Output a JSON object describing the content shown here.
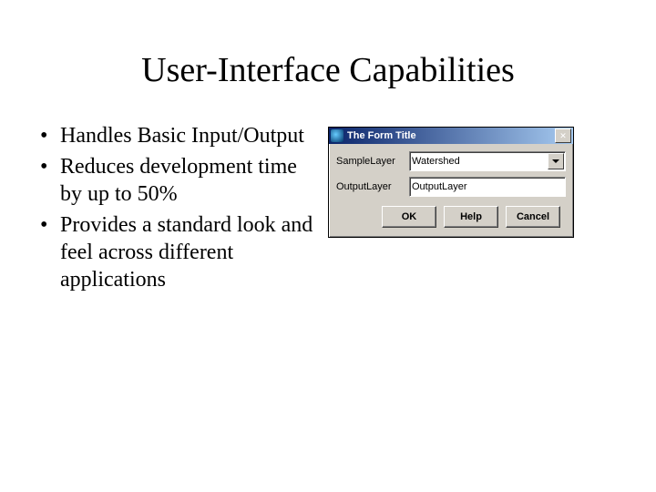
{
  "slide": {
    "title": "User-Interface Capabilities",
    "bullets": [
      "Handles Basic Input/Output",
      "Reduces development time by up to 50%",
      "Provides a standard look and feel across different applications"
    ]
  },
  "dialog": {
    "title": "The Form Title",
    "fields": {
      "sample_label": "SampleLayer",
      "sample_value": "Watershed",
      "output_label": "OutputLayer",
      "output_value": "OutputLayer"
    },
    "buttons": {
      "ok": "OK",
      "help": "Help",
      "cancel": "Cancel"
    }
  }
}
